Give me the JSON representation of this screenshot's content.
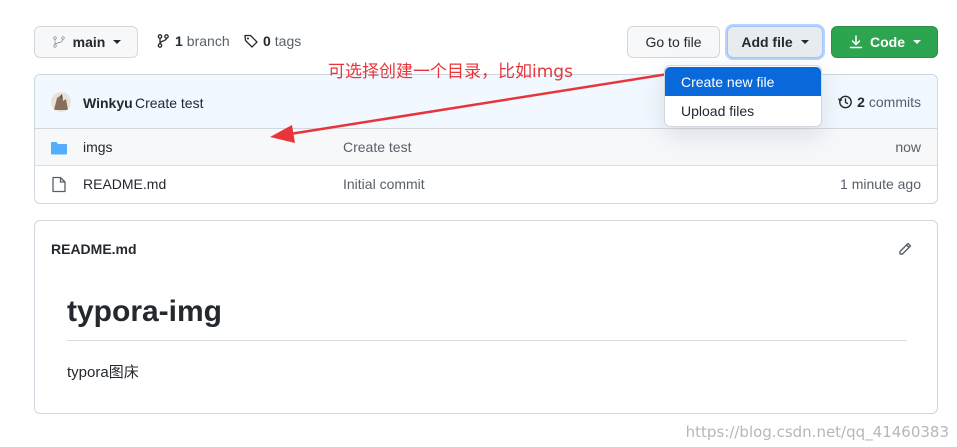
{
  "toolbar": {
    "branch_select": "main",
    "branches_count": "1",
    "branches_label": "branch",
    "tags_count": "0",
    "tags_label": "tags",
    "go_to_file": "Go to file",
    "add_file": "Add file",
    "code": "Code"
  },
  "add_file_menu": {
    "items": [
      {
        "label": "Create new file"
      },
      {
        "label": "Upload files"
      }
    ]
  },
  "annotation": {
    "text": "可选择创建一个目录，比如imgs",
    "color": "#e8353a"
  },
  "latest_commit": {
    "author": "Winkyu",
    "message": "Create test",
    "commits_count": "2",
    "commits_label": "commits"
  },
  "files": [
    {
      "name": "imgs",
      "type": "folder",
      "message": "Create test",
      "age": "now"
    },
    {
      "name": "README.md",
      "type": "file",
      "message": "Initial commit",
      "age": "1 minute ago"
    }
  ],
  "readme": {
    "file_name": "README.md",
    "heading": "typora-img",
    "body": "typora图床"
  },
  "watermark": "https://blog.csdn.net/qq_41460383",
  "colors": {
    "code_button": "#2da44e",
    "folder_icon": "#54aeff",
    "commit_bar_bg": "#f1f8ff",
    "menu_active": "#0969da",
    "arrow": "#e8353a"
  }
}
